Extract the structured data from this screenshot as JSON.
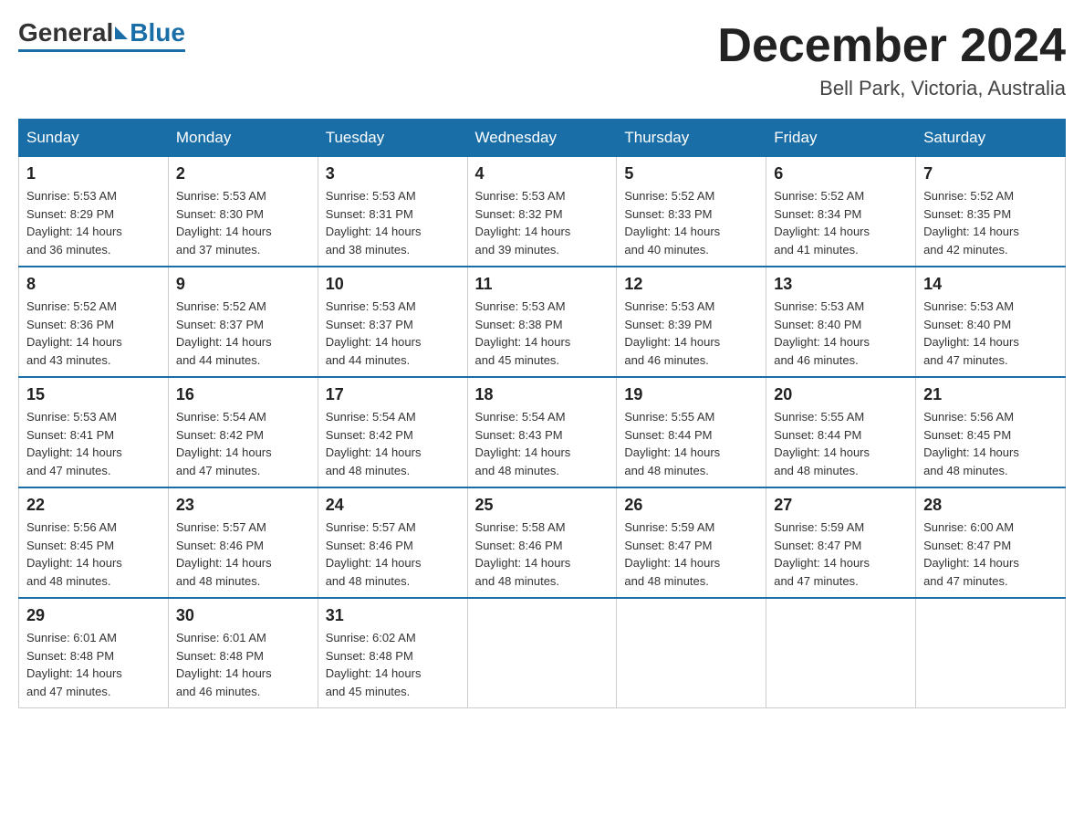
{
  "header": {
    "logo": {
      "general": "General",
      "blue": "Blue"
    },
    "title": "December 2024",
    "location": "Bell Park, Victoria, Australia"
  },
  "calendar": {
    "days_of_week": [
      "Sunday",
      "Monday",
      "Tuesday",
      "Wednesday",
      "Thursday",
      "Friday",
      "Saturday"
    ],
    "weeks": [
      [
        {
          "day": "1",
          "sunrise": "5:53 AM",
          "sunset": "8:29 PM",
          "daylight": "14 hours and 36 minutes."
        },
        {
          "day": "2",
          "sunrise": "5:53 AM",
          "sunset": "8:30 PM",
          "daylight": "14 hours and 37 minutes."
        },
        {
          "day": "3",
          "sunrise": "5:53 AM",
          "sunset": "8:31 PM",
          "daylight": "14 hours and 38 minutes."
        },
        {
          "day": "4",
          "sunrise": "5:53 AM",
          "sunset": "8:32 PM",
          "daylight": "14 hours and 39 minutes."
        },
        {
          "day": "5",
          "sunrise": "5:52 AM",
          "sunset": "8:33 PM",
          "daylight": "14 hours and 40 minutes."
        },
        {
          "day": "6",
          "sunrise": "5:52 AM",
          "sunset": "8:34 PM",
          "daylight": "14 hours and 41 minutes."
        },
        {
          "day": "7",
          "sunrise": "5:52 AM",
          "sunset": "8:35 PM",
          "daylight": "14 hours and 42 minutes."
        }
      ],
      [
        {
          "day": "8",
          "sunrise": "5:52 AM",
          "sunset": "8:36 PM",
          "daylight": "14 hours and 43 minutes."
        },
        {
          "day": "9",
          "sunrise": "5:52 AM",
          "sunset": "8:37 PM",
          "daylight": "14 hours and 44 minutes."
        },
        {
          "day": "10",
          "sunrise": "5:53 AM",
          "sunset": "8:37 PM",
          "daylight": "14 hours and 44 minutes."
        },
        {
          "day": "11",
          "sunrise": "5:53 AM",
          "sunset": "8:38 PM",
          "daylight": "14 hours and 45 minutes."
        },
        {
          "day": "12",
          "sunrise": "5:53 AM",
          "sunset": "8:39 PM",
          "daylight": "14 hours and 46 minutes."
        },
        {
          "day": "13",
          "sunrise": "5:53 AM",
          "sunset": "8:40 PM",
          "daylight": "14 hours and 46 minutes."
        },
        {
          "day": "14",
          "sunrise": "5:53 AM",
          "sunset": "8:40 PM",
          "daylight": "14 hours and 47 minutes."
        }
      ],
      [
        {
          "day": "15",
          "sunrise": "5:53 AM",
          "sunset": "8:41 PM",
          "daylight": "14 hours and 47 minutes."
        },
        {
          "day": "16",
          "sunrise": "5:54 AM",
          "sunset": "8:42 PM",
          "daylight": "14 hours and 47 minutes."
        },
        {
          "day": "17",
          "sunrise": "5:54 AM",
          "sunset": "8:42 PM",
          "daylight": "14 hours and 48 minutes."
        },
        {
          "day": "18",
          "sunrise": "5:54 AM",
          "sunset": "8:43 PM",
          "daylight": "14 hours and 48 minutes."
        },
        {
          "day": "19",
          "sunrise": "5:55 AM",
          "sunset": "8:44 PM",
          "daylight": "14 hours and 48 minutes."
        },
        {
          "day": "20",
          "sunrise": "5:55 AM",
          "sunset": "8:44 PM",
          "daylight": "14 hours and 48 minutes."
        },
        {
          "day": "21",
          "sunrise": "5:56 AM",
          "sunset": "8:45 PM",
          "daylight": "14 hours and 48 minutes."
        }
      ],
      [
        {
          "day": "22",
          "sunrise": "5:56 AM",
          "sunset": "8:45 PM",
          "daylight": "14 hours and 48 minutes."
        },
        {
          "day": "23",
          "sunrise": "5:57 AM",
          "sunset": "8:46 PM",
          "daylight": "14 hours and 48 minutes."
        },
        {
          "day": "24",
          "sunrise": "5:57 AM",
          "sunset": "8:46 PM",
          "daylight": "14 hours and 48 minutes."
        },
        {
          "day": "25",
          "sunrise": "5:58 AM",
          "sunset": "8:46 PM",
          "daylight": "14 hours and 48 minutes."
        },
        {
          "day": "26",
          "sunrise": "5:59 AM",
          "sunset": "8:47 PM",
          "daylight": "14 hours and 48 minutes."
        },
        {
          "day": "27",
          "sunrise": "5:59 AM",
          "sunset": "8:47 PM",
          "daylight": "14 hours and 47 minutes."
        },
        {
          "day": "28",
          "sunrise": "6:00 AM",
          "sunset": "8:47 PM",
          "daylight": "14 hours and 47 minutes."
        }
      ],
      [
        {
          "day": "29",
          "sunrise": "6:01 AM",
          "sunset": "8:48 PM",
          "daylight": "14 hours and 47 minutes."
        },
        {
          "day": "30",
          "sunrise": "6:01 AM",
          "sunset": "8:48 PM",
          "daylight": "14 hours and 46 minutes."
        },
        {
          "day": "31",
          "sunrise": "6:02 AM",
          "sunset": "8:48 PM",
          "daylight": "14 hours and 45 minutes."
        },
        null,
        null,
        null,
        null
      ]
    ],
    "labels": {
      "sunrise": "Sunrise:",
      "sunset": "Sunset:",
      "daylight": "Daylight:"
    }
  }
}
